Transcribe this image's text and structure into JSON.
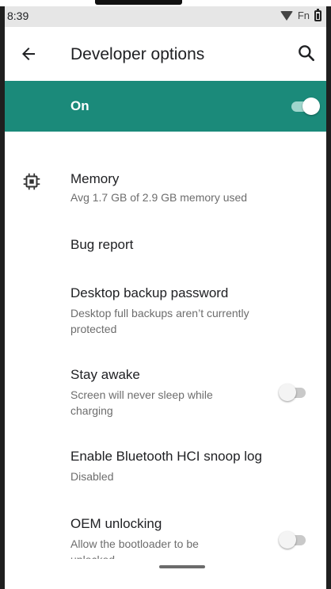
{
  "status_bar": {
    "time": "8:39",
    "network_label": "Fn"
  },
  "app_bar": {
    "title": "Developer options"
  },
  "master_switch": {
    "label": "On",
    "state": "on",
    "accent": "#1b8a7a"
  },
  "settings": [
    {
      "title": "Memory",
      "summary": "Avg 1.7 GB of 2.9 GB memory used",
      "icon": "memory-chip-icon"
    },
    {
      "title": "Bug report"
    },
    {
      "title": "Desktop backup password",
      "summary_lines": [
        "Desktop full backups aren’t currently",
        "protected"
      ]
    },
    {
      "title": "Stay awake",
      "summary_lines": [
        "Screen will never sleep while",
        "charging"
      ],
      "toggle": "off"
    },
    {
      "title": "Enable Bluetooth HCI snoop log",
      "summary": "Disabled"
    },
    {
      "title": "OEM unlocking",
      "summary_lines": [
        "Allow the bootloader to be",
        "unlocked"
      ],
      "toggle": "off"
    }
  ]
}
